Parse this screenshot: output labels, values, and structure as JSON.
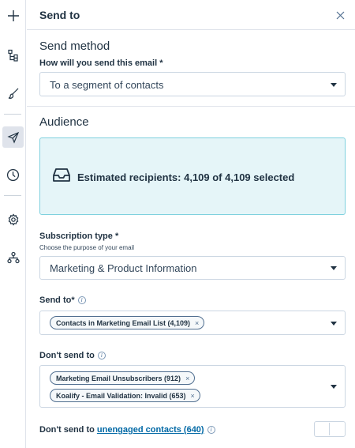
{
  "rail": {
    "items": [
      {
        "icon": "plus-icon"
      },
      {
        "icon": "flow-tree-icon"
      },
      {
        "icon": "brush-icon"
      },
      {
        "icon": "send-icon",
        "active": true
      },
      {
        "icon": "clock-icon"
      },
      {
        "icon": "gear-icon"
      },
      {
        "icon": "connections-icon"
      }
    ]
  },
  "header": {
    "title": "Send to",
    "close_icon": "close-icon"
  },
  "send_method": {
    "title": "Send method",
    "label": "How will you send this email *",
    "value": "To a segment of contacts"
  },
  "audience": {
    "title": "Audience",
    "estimate_icon": "inbox-icon",
    "estimate_text": "Estimated recipients: 4,109 of 4,109 selected"
  },
  "subscription": {
    "label": "Subscription type *",
    "help": "Choose the purpose of your email",
    "value": "Marketing & Product Information"
  },
  "send_to": {
    "label": "Send to*",
    "tags": [
      "Contacts in Marketing Email List (4,109)"
    ]
  },
  "dont_send": {
    "label": "Don't send to",
    "tags": [
      "Marketing Email Unsubscribers (912)",
      "Koalify - Email Validation: Invalid (653)"
    ]
  },
  "unengaged": {
    "prefix": "Don't send to ",
    "link": "unengaged contacts (640)",
    "enabled": false
  },
  "glyphs": {
    "remove": "×",
    "info": "i"
  },
  "colors": {
    "accent_link": "#0068a5",
    "info_bg": "#e5f5f8",
    "info_border": "#7fd1de"
  }
}
